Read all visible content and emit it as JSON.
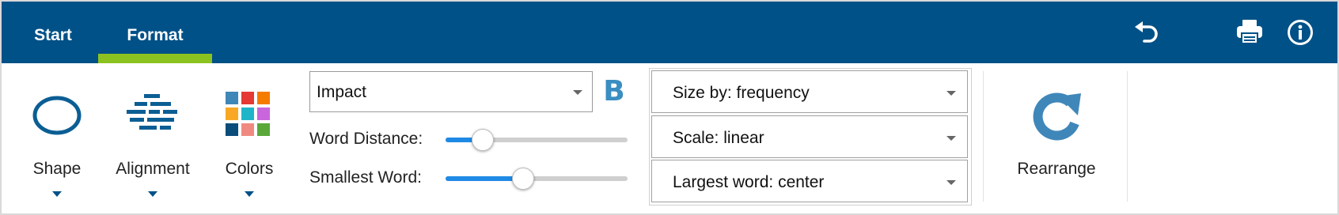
{
  "tabs": [
    {
      "label": "Start"
    },
    {
      "label": "Format"
    }
  ],
  "accent_color": "#8cc21f",
  "topbar_color": "#005187",
  "topbar_icons": [
    "undo-icon",
    "print-icon",
    "info-icon"
  ],
  "ribbon": {
    "shape": {
      "label": "Shape",
      "icon": "ellipse-icon"
    },
    "alignment": {
      "label": "Alignment",
      "icon": "brick-alignment-icon"
    },
    "colors": {
      "label": "Colors",
      "icon": "color-palette-icon",
      "swatches": [
        "#3f87b9",
        "#e53935",
        "#f57c00",
        "#f9a825",
        "#1fb5c8",
        "#c966dd",
        "#0b4d7a",
        "#f08a80",
        "#5aa83a"
      ]
    },
    "font": {
      "value": "Impact"
    },
    "bold_label": "B",
    "word_distance": {
      "label": "Word Distance:",
      "percent": 20
    },
    "smallest_word": {
      "label": "Smallest Word:",
      "percent": 42
    },
    "size_by": {
      "value": "Size by: frequency"
    },
    "scale": {
      "value": "Scale: linear"
    },
    "largest_word": {
      "value": "Largest word: center"
    },
    "rearrange": {
      "label": "Rearrange",
      "icon": "refresh-icon"
    }
  }
}
